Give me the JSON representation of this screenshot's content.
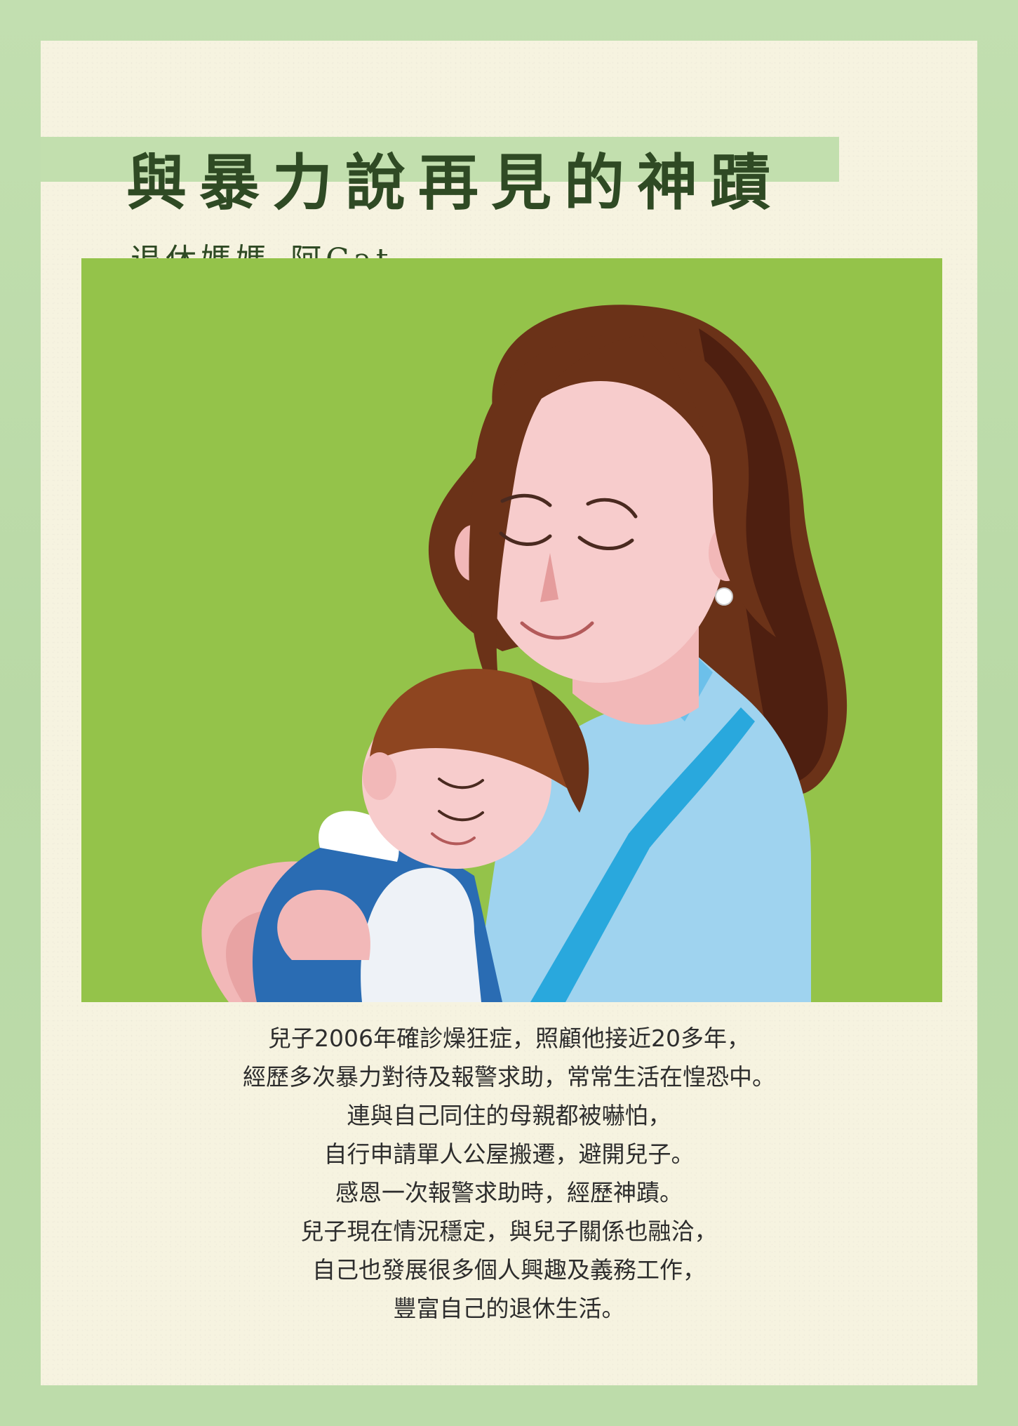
{
  "poster": {
    "title": "與暴力說再見的神蹟",
    "author_role": "退休媽媽",
    "author_name": "阿Cat",
    "illustration": "mother-hugging-sleeping-child",
    "colors": {
      "frame": "#bcdcaa",
      "paper": "#f6f3e0",
      "title_band": "#c2dfae",
      "title_text": "#2f4a24",
      "illustration_bg": "#94c34a",
      "body_text": "#2d2d2d"
    },
    "story_lines": [
      "兒子2006年確診燥狂症，照顧他接近20多年，",
      "經歷多次暴力對待及報警求助，常常生活在惶恐中。",
      "連與自己同住的母親都被嚇怕，",
      "自行申請單人公屋搬遷，避開兒子。",
      "感恩一次報警求助時，經歷神蹟。",
      "兒子現在情況穩定，與兒子關係也融洽，",
      "自己也發展很多個人興趣及義務工作，",
      "豐富自己的退休生活。"
    ]
  }
}
